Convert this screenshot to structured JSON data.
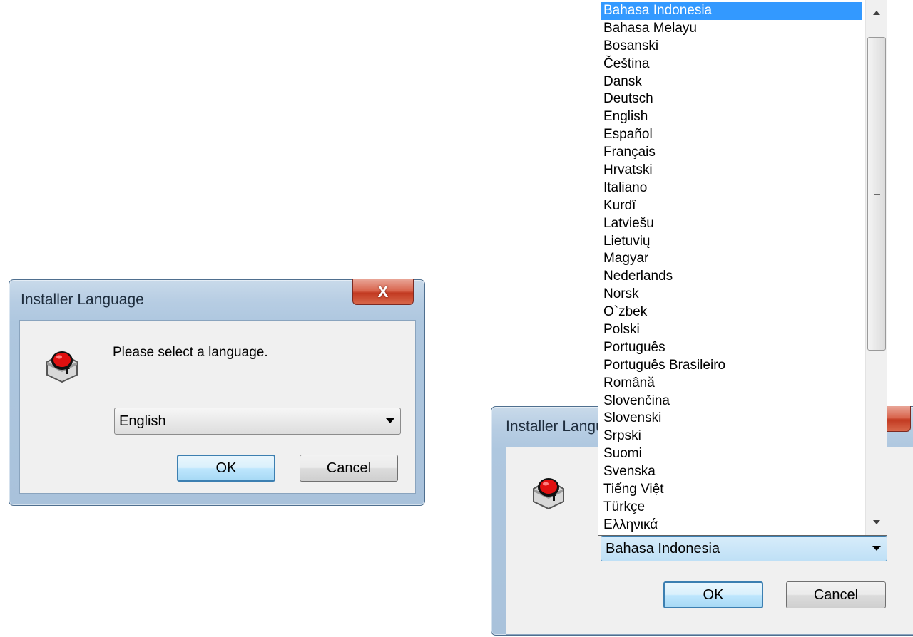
{
  "dialog1": {
    "title": "Installer Language",
    "close_symbol": "X",
    "prompt": "Please select a language.",
    "selected_language": "English",
    "ok_label": "OK",
    "cancel_label": "Cancel",
    "icon": "installer-app-icon"
  },
  "dialog2": {
    "title": "Installer Language",
    "selected_language": "Bahasa Indonesia",
    "ok_label": "OK",
    "cancel_label": "Cancel",
    "icon": "installer-app-icon"
  },
  "dropdown": {
    "options": [
      "Bahasa Indonesia",
      "Bahasa Melayu",
      "Bosanski",
      "Čeština",
      "Dansk",
      "Deutsch",
      "English",
      "Español",
      "Français",
      "Hrvatski",
      "Italiano",
      "Kurdî",
      "Latviešu",
      "Lietuvių",
      "Magyar",
      "Nederlands",
      "Norsk",
      "O`zbek",
      "Polski",
      "Português",
      "Português Brasileiro",
      "Română",
      "Slovenčina",
      "Slovenski",
      "Srpski",
      "Suomi",
      "Svenska",
      "Tiếng Việt",
      "Türkçe",
      "Ελληνικά"
    ],
    "highlighted": "Bahasa Indonesia"
  },
  "colors": {
    "selection": "#3399ff",
    "close_button": "#c23a21",
    "window_frame": "#aec7df"
  }
}
